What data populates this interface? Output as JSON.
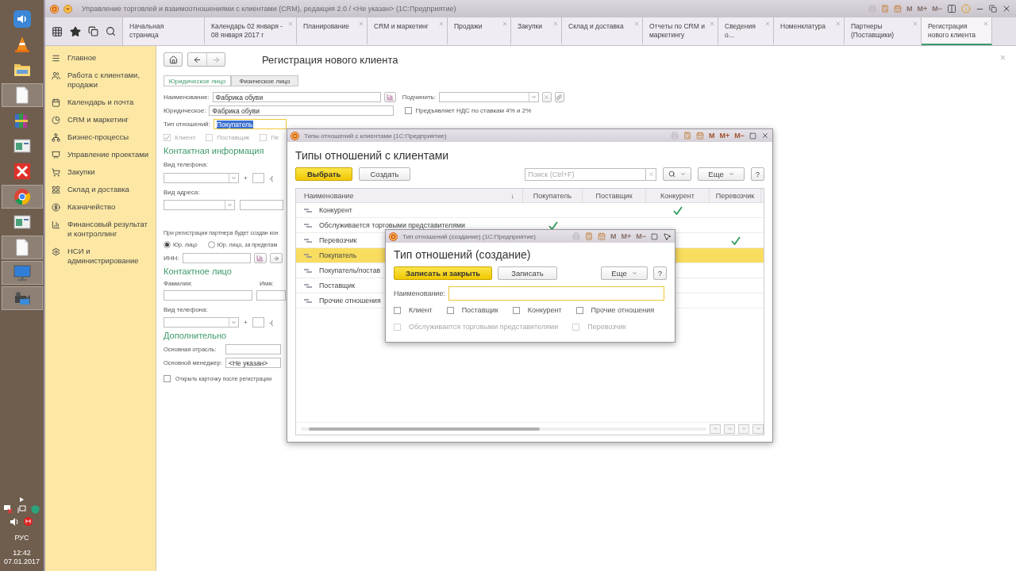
{
  "taskbar": {
    "apps": [
      {
        "kind": "speaker",
        "active": false
      },
      {
        "kind": "cone",
        "active": false
      },
      {
        "kind": "folder",
        "active": false
      },
      {
        "kind": "document",
        "active": true
      },
      {
        "kind": "books",
        "active": false
      },
      {
        "kind": "window",
        "active": false
      },
      {
        "kind": "cross",
        "active": false
      },
      {
        "kind": "browser",
        "active": true
      },
      {
        "kind": "window",
        "active": false
      },
      {
        "kind": "document",
        "active": true
      },
      {
        "kind": "monitor",
        "active": true
      },
      {
        "kind": "camera",
        "active": true
      }
    ],
    "language": "РУС",
    "time": "12:42",
    "date": "07.01.2017"
  },
  "window": {
    "title": "Управление торговлей и взаимоотношениями с клиентами (CRM), редакция 2.0 / <Не указан>  (1С:Предприятие)",
    "memory_buttons": {
      "labels": [
        "M",
        "M+",
        "M−"
      ],
      "disabled": true
    }
  },
  "tabs": [
    {
      "label": "Начальная страница",
      "closable": false,
      "selected": false
    },
    {
      "label": "Календарь 02 января - 08 января 2017 г",
      "closable": true,
      "selected": false
    },
    {
      "label": "Планирование",
      "closable": true,
      "selected": false
    },
    {
      "label": "CRM и маркетинг",
      "closable": true,
      "selected": false
    },
    {
      "label": "Продажи",
      "closable": true,
      "selected": false
    },
    {
      "label": "Закупки",
      "closable": true,
      "selected": false
    },
    {
      "label": "Склад и доставка",
      "closable": true,
      "selected": false
    },
    {
      "label": "Отчеты по CRM и маркетингу",
      "closable": true,
      "selected": false
    },
    {
      "label": "Сведения о...",
      "closable": true,
      "selected": false
    },
    {
      "label": "Номенклатура",
      "closable": true,
      "selected": false
    },
    {
      "label": "Партнеры (Поставщики)",
      "closable": true,
      "selected": false
    },
    {
      "label": "Регистрация нового клиента",
      "closable": true,
      "selected": true
    }
  ],
  "sidebar": {
    "items": [
      {
        "label": "Главное"
      },
      {
        "label": "Работа с клиентами, продажи"
      },
      {
        "label": "Календарь и почта"
      },
      {
        "label": "CRM и маркетинг"
      },
      {
        "label": "Бизнес-процессы"
      },
      {
        "label": "Управление проектами"
      },
      {
        "label": "Закупки"
      },
      {
        "label": "Склад и доставка"
      },
      {
        "label": "Казначейство"
      },
      {
        "label": "Финансовый результат и контроллинг"
      },
      {
        "label": "НСИ и администрирование"
      }
    ]
  },
  "form": {
    "title": "Регистрация нового клиента",
    "person_tabs": [
      {
        "label": "Юридическое лицо",
        "selected": true
      },
      {
        "label": "Физическое лицо",
        "selected": false
      }
    ],
    "name": {
      "label": "Наименование:",
      "value": "Фабрика обуви"
    },
    "subordinate": {
      "label": "Подчинить:"
    },
    "legal_name": {
      "label": "Юридическое:",
      "value": "Фабрика обуви"
    },
    "vat": {
      "label": "Предъявляет НДС по ставкам 4% и 2%",
      "checked": false
    },
    "relation_type": {
      "label": "Тип отношений:",
      "value": "Покупатель"
    },
    "relation_flags": [
      {
        "label": "Клиент",
        "checked": true,
        "disabled": true
      },
      {
        "label": "Поставщик",
        "checked": false,
        "disabled": true
      },
      {
        "label": "Пе",
        "checked": false,
        "disabled": true
      }
    ],
    "contact_info": {
      "heading": "Контактная информация",
      "phone_label": "Вид телефона:",
      "plus": "+",
      "dash": "-(",
      "address_label": "Вид адреса:"
    },
    "registration_note": "При регистрации партнера будет создан кон",
    "entity_options": [
      {
        "label": "Юр. лицо",
        "selected": true
      },
      {
        "label": "Юр. лицо, за пределам",
        "selected": false
      }
    ],
    "inn_label": "ИНН:",
    "contact_person": {
      "heading": "Контактное лицо",
      "last_name_label": "Фамилия:",
      "first_name_label": "Имя:",
      "phone_label": "Вид телефона:",
      "plus": "+",
      "dash": "-("
    },
    "additional": {
      "heading": "Дополнительно",
      "industry_label": "Основная отрасль:",
      "manager_label": "Основной менеджер:",
      "manager_value": "<Не указан>"
    },
    "open_card": {
      "label": "Открыть карточку после регистрации",
      "checked": false
    }
  },
  "list_dialog": {
    "window_title": "Типы отношений с клиентами  (1С:Предприятие)",
    "memory_buttons": {
      "labels": [
        "M",
        "M+",
        "M−"
      ],
      "disabled": false
    },
    "title": "Типы отношений с клиентами",
    "select_button": "Выбрать",
    "create_button": "Создать",
    "search": {
      "placeholder": "Поиск (Ctrl+F)"
    },
    "more_button": "Еще",
    "help_button": "?",
    "sort_mark": "↓",
    "columns": [
      "Наименование",
      "Покупатель",
      "Поставщик",
      "Конкурент",
      "Перевозчик"
    ],
    "rows": [
      {
        "name": "Конкурент",
        "selected": false,
        "flags": [
          false,
          false,
          true,
          false
        ]
      },
      {
        "name": "Обслуживается торговыми представителями",
        "selected": false,
        "flags": [
          true,
          false,
          false,
          false
        ]
      },
      {
        "name": "Перевозчик",
        "selected": false,
        "flags": [
          false,
          false,
          false,
          true
        ]
      },
      {
        "name": "Покупатель",
        "selected": true,
        "flags": [
          false,
          false,
          false,
          false
        ]
      },
      {
        "name": "Покупатель/постав",
        "selected": false,
        "flags": [
          false,
          false,
          false,
          false
        ]
      },
      {
        "name": "Поставщик",
        "selected": false,
        "flags": [
          false,
          false,
          false,
          false
        ]
      },
      {
        "name": "Прочие отношения",
        "selected": false,
        "flags": [
          false,
          false,
          false,
          false
        ]
      }
    ]
  },
  "create_dialog": {
    "window_title": "Тип отношений (создание)  (1С:Предприятие)",
    "memory_buttons": {
      "labels": [
        "M",
        "M+",
        "M−"
      ],
      "disabled": true
    },
    "title": "Тип отношений (создание)",
    "save_close_button": "Записать и закрыть",
    "save_button": "Записать",
    "more_button": "Еще",
    "help_button": "?",
    "name_label": "Наименование:",
    "options": [
      {
        "label": "Клиент",
        "checked": false,
        "disabled": false
      },
      {
        "label": "Поставщик",
        "checked": false,
        "disabled": false
      },
      {
        "label": "Конкурент",
        "checked": false,
        "disabled": false
      },
      {
        "label": "Прочие отношения",
        "checked": false,
        "disabled": false
      },
      {
        "label": "Обслуживается торговыми представителями",
        "checked": false,
        "disabled": true
      },
      {
        "label": "Перевозчик",
        "checked": false,
        "disabled": true
      }
    ]
  }
}
